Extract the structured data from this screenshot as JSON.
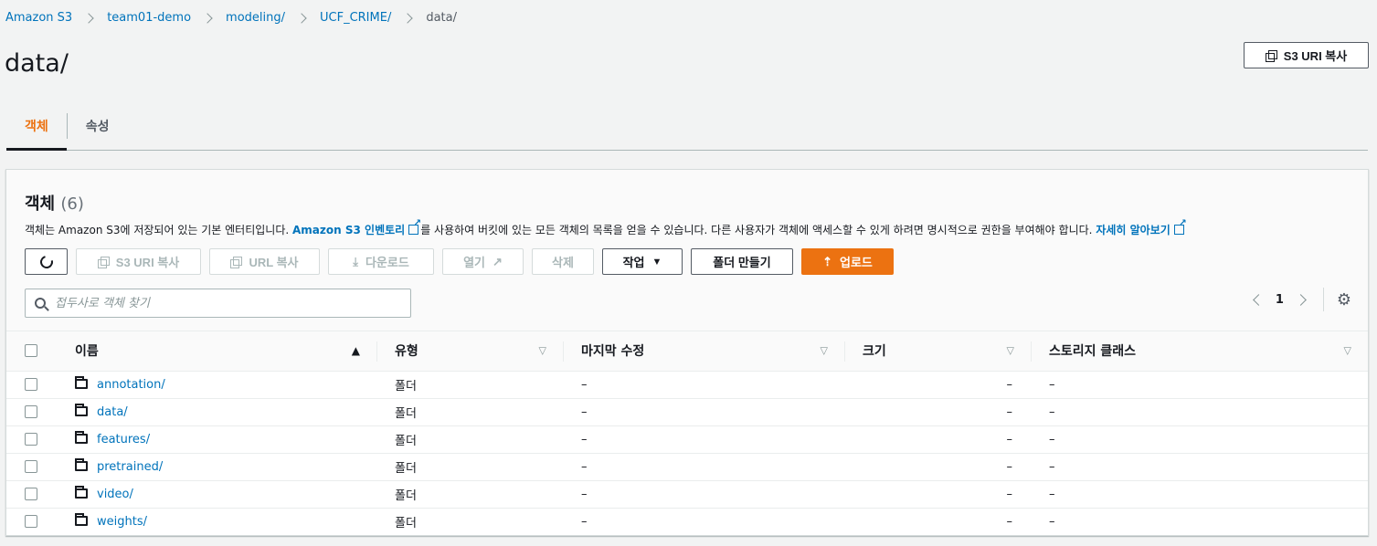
{
  "breadcrumb": [
    "Amazon S3",
    "team01-demo",
    "modeling/",
    "UCF_CRIME/",
    "data/"
  ],
  "page_title": "data/",
  "copy_s3_uri_label": "S3 URI 복사",
  "tabs": [
    {
      "label": "객체",
      "active": true
    },
    {
      "label": "속성",
      "active": false
    }
  ],
  "panel": {
    "title": "객체",
    "count": "(6)",
    "desc_prefix": "객체는 Amazon S3에 저장되어 있는 기본 엔터티입니다.",
    "desc_link1": "Amazon S3 인벤토리",
    "desc_middle": "를 사용하여 버킷에 있는 모든 객체의 목록을 얻을 수 있습니다. 다른 사용자가 객체에 액세스할 수 있게 하려면 명시적으로 권한을 부여해야 합니다.",
    "desc_link2": "자세히 알아보기"
  },
  "toolbar": {
    "copy_s3_uri": "S3 URI 복사",
    "copy_url": "URL 복사",
    "download": "다운로드",
    "open": "열기",
    "delete": "삭제",
    "actions": "작업",
    "create_folder": "폴더 만들기",
    "upload": "업로드"
  },
  "search": {
    "placeholder": "접두사로 객체 찾기"
  },
  "pagination": {
    "current_page": "1"
  },
  "columns": [
    "이름",
    "유형",
    "마지막 수정",
    "크기",
    "스토리지 클래스"
  ],
  "rows": [
    {
      "name": "annotation/",
      "type": "폴더",
      "modified": "–",
      "size": "–",
      "storage": "–"
    },
    {
      "name": "data/",
      "type": "폴더",
      "modified": "–",
      "size": "–",
      "storage": "–"
    },
    {
      "name": "features/",
      "type": "폴더",
      "modified": "–",
      "size": "–",
      "storage": "–"
    },
    {
      "name": "pretrained/",
      "type": "폴더",
      "modified": "–",
      "size": "–",
      "storage": "–"
    },
    {
      "name": "video/",
      "type": "폴더",
      "modified": "–",
      "size": "–",
      "storage": "–"
    },
    {
      "name": "weights/",
      "type": "폴더",
      "modified": "–",
      "size": "–",
      "storage": "–"
    }
  ],
  "colors": {
    "link": "#0073bb",
    "accent": "#ec7211",
    "background": "#f2f3f3"
  }
}
